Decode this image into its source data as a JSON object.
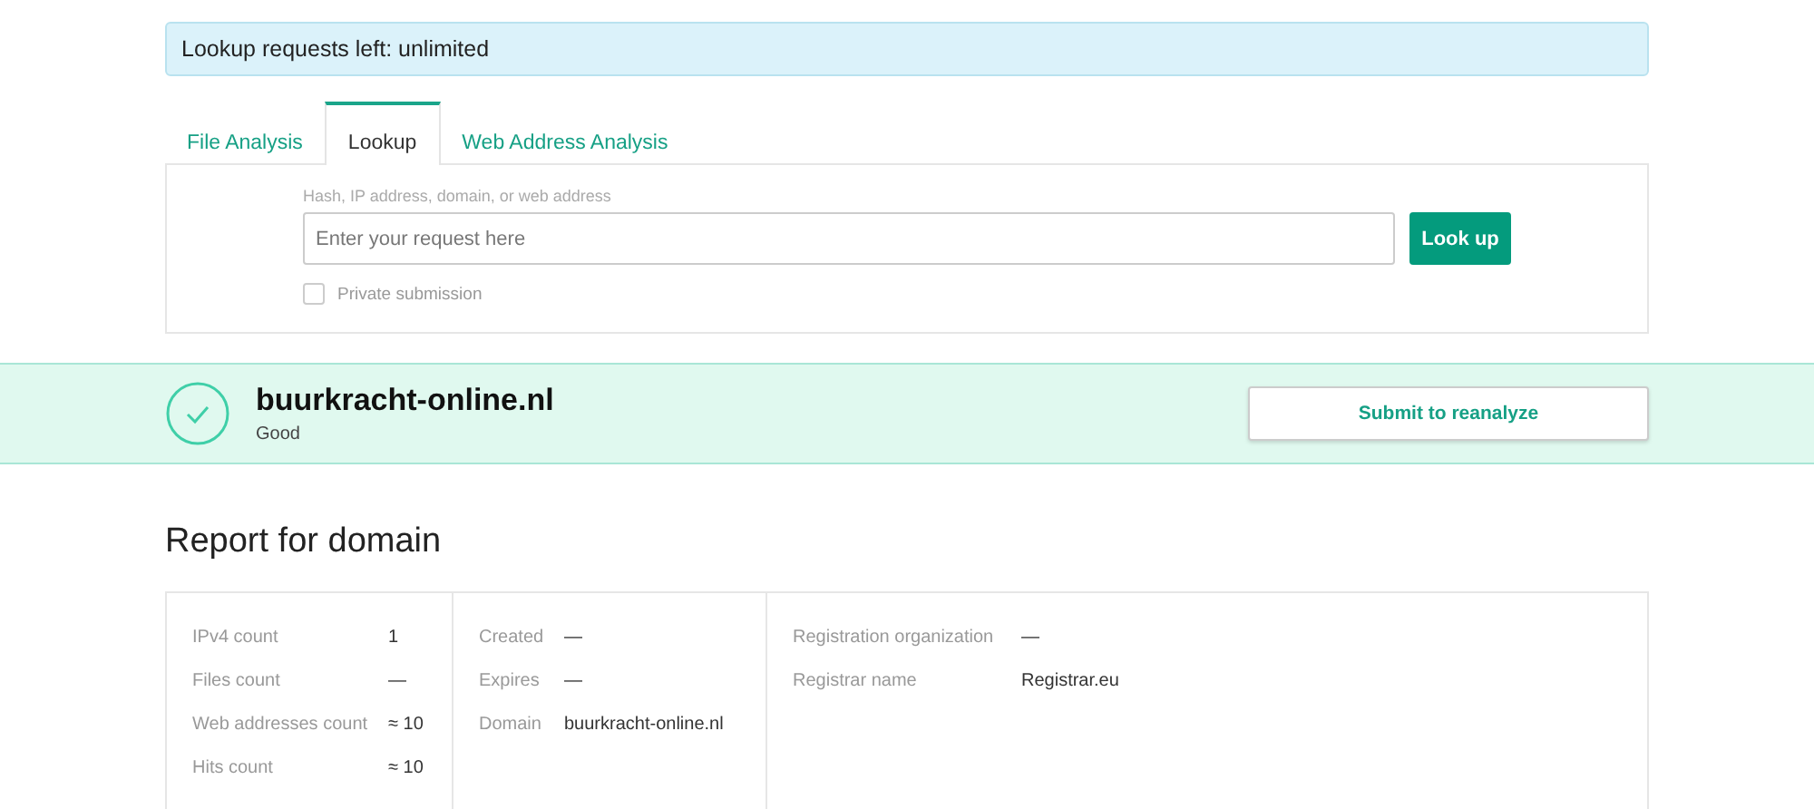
{
  "notice": "Lookup requests left: unlimited",
  "tabs": [
    {
      "label": "File Analysis",
      "selected": false
    },
    {
      "label": "Lookup",
      "selected": true
    },
    {
      "label": "Web Address Analysis",
      "selected": false
    }
  ],
  "lookup_form": {
    "label": "Hash, IP address, domain, or web address",
    "placeholder": "Enter your request here",
    "button": "Look up",
    "private_submission": {
      "label": "Private submission",
      "checked": false
    }
  },
  "result": {
    "domain": "buurkracht-online.nl",
    "verdict": "Good",
    "button": "Submit to reanalyze"
  },
  "report": {
    "title": "Report for domain",
    "columns": [
      [
        {
          "label": "IPv4 count",
          "value": "1"
        },
        {
          "label": "Files count",
          "value": "—"
        },
        {
          "label": "Web addresses count",
          "value": "≈ 10"
        },
        {
          "label": "Hits count",
          "value": "≈ 10"
        }
      ],
      [
        {
          "label": "Created",
          "value": "—"
        },
        {
          "label": "Expires",
          "value": "—"
        },
        {
          "label": "Domain",
          "value": "buurkracht-online.nl"
        }
      ],
      [
        {
          "label": "Registration organization",
          "value": "—"
        },
        {
          "label": "Registrar name",
          "value": "Registrar.eu"
        }
      ]
    ]
  }
}
